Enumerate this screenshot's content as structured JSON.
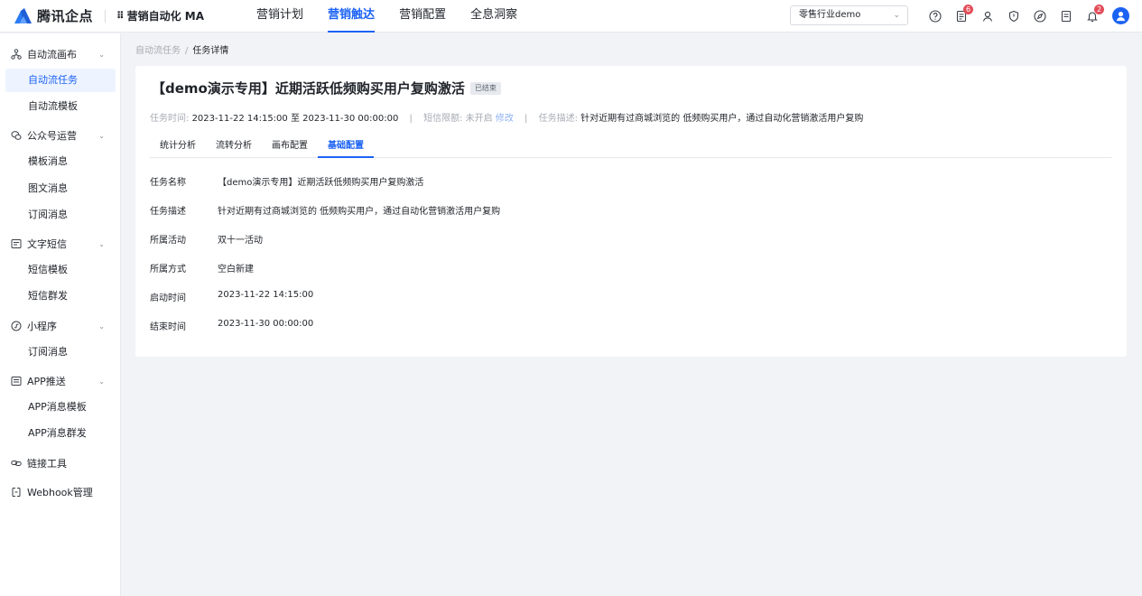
{
  "header": {
    "logo_text": "腾讯企点",
    "product_icon": "grid-icon",
    "product_name": "营销自动化 MA",
    "nav": [
      "营销计划",
      "营销触达",
      "营销配置",
      "全息洞察"
    ],
    "active_nav": "营销触达",
    "industry_select": "零售行业demo",
    "badges": {
      "tasks": "6",
      "notifications": "2"
    },
    "accent_color": "#1c63f4"
  },
  "sidebar": {
    "groups": [
      {
        "label": "自动流画布",
        "icon": "flow-icon"
      },
      {
        "label": "公众号运营",
        "icon": "wechat-icon"
      },
      {
        "label": "文字短信",
        "icon": "message-icon"
      },
      {
        "label": "小程序",
        "icon": "miniprogram-icon"
      },
      {
        "label": "APP推送",
        "icon": "app-push-icon"
      },
      {
        "label": "链接工具",
        "icon": "link-icon"
      },
      {
        "label": "Webhook管理",
        "icon": "webhook-icon"
      }
    ],
    "items": [
      "自动流任务",
      "自动流模板",
      "模板消息",
      "图文消息",
      "订阅消息",
      "短信模板",
      "短信群发",
      "订阅消息",
      "APP消息模板",
      "APP消息群发"
    ],
    "active_item": "自动流任务"
  },
  "breadcrumb": {
    "parent": "自动流任务",
    "separator": "/",
    "current": "任务详情"
  },
  "task": {
    "title": "【demo演示专用】近期活跃低频购买用户复购激活",
    "status": "已结束",
    "time_label": "任务时间:",
    "time_value": "2023-11-22 14:15:00 至 2023-11-30 00:00:00",
    "sms_label": "短信限额:",
    "sms_value": "未开启",
    "sms_edit": "修改",
    "desc_label": "任务描述:",
    "desc_value": "针对近期有过商城浏览的 低频购买用户，通过自动化营销激活用户复购",
    "meta_separator": "|"
  },
  "tabs": [
    "统计分析",
    "流转分析",
    "画布配置",
    "基础配置"
  ],
  "active_tab": "基础配置",
  "fields": [
    {
      "label": "任务名称",
      "value": "【demo演示专用】近期活跃低频购买用户复购激活"
    },
    {
      "label": "任务描述",
      "value": "针对近期有过商城浏览的 低频购买用户，通过自动化营销激活用户复购"
    },
    {
      "label": "所属活动",
      "value": "双十一活动"
    },
    {
      "label": "所属方式",
      "value": "空白新建"
    },
    {
      "label": "启动时间",
      "value": "2023-11-22 14:15:00"
    },
    {
      "label": "结束时间",
      "value": "2023-11-30 00:00:00"
    }
  ]
}
